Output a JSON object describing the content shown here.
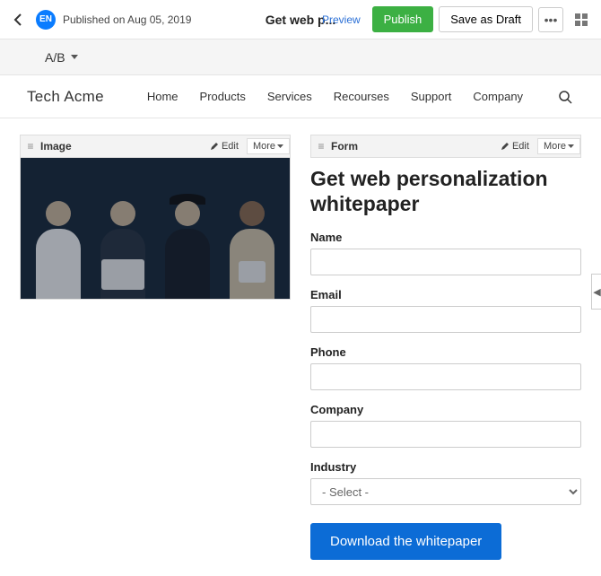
{
  "topbar": {
    "lang": "EN",
    "published": "Published on Aug 05, 2019",
    "title": "Get web p...",
    "preview": "Preview",
    "publish": "Publish",
    "draft": "Save as Draft",
    "more": "•••"
  },
  "ab": {
    "label": "A/B"
  },
  "brand": "Tech Acme",
  "nav": [
    "Home",
    "Products",
    "Services",
    "Recourses",
    "Support",
    "Company"
  ],
  "image_block": {
    "label": "Image",
    "edit": "Edit",
    "more": "More"
  },
  "form_block": {
    "label": "Form",
    "edit": "Edit",
    "more": "More"
  },
  "form": {
    "title": "Get web personalization whitepaper",
    "name": "Name",
    "email": "Email",
    "phone": "Phone",
    "company": "Company",
    "industry": "Industry",
    "industry_placeholder": "- Select -",
    "submit": "Download the whitepaper"
  }
}
